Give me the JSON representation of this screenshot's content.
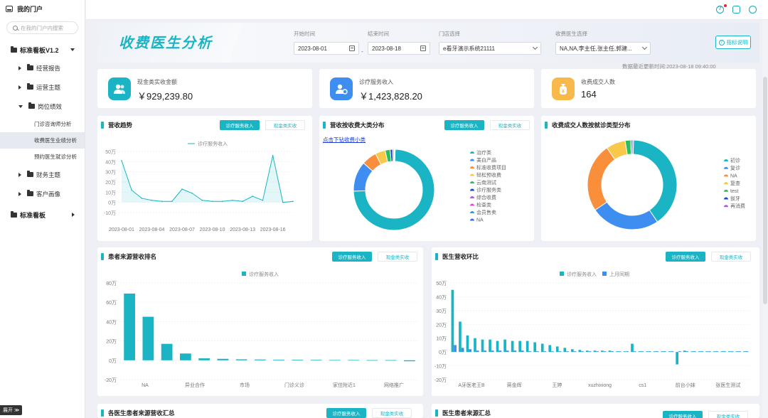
{
  "sidebar": {
    "portal": "我的门户",
    "search_placeholder": "在我的门户内搜索",
    "group1": "标准看板V1.2",
    "items": [
      "经营报告",
      "运营主题",
      "岗位绩效",
      "财务主题",
      "客户画像"
    ],
    "sub_items": [
      "门诊咨询师分析",
      "收费医生业绩分析",
      "预约医生就诊分析"
    ],
    "group2": "标准看板",
    "expand": "展开 ≫"
  },
  "header": {
    "title": "收费医生分析",
    "filters": {
      "start_label": "开始时间",
      "start_value": "2023-08-01",
      "end_label": "结束时间",
      "end_value": "2023-08-18",
      "store_label": "门店选择",
      "store_value": "e看牙演示系统21111",
      "doctor_label": "收费医生选择",
      "doctor_value": "NA,NA,李主任,张主任,郭建..."
    },
    "dash": "-",
    "doc_button": "指标说明",
    "update_time": "数据最近更新时间:2023-08-18 09:40:00"
  },
  "kpis": [
    {
      "label": "现金类实收金额",
      "value": "￥929,239.80",
      "color": "#1ab4c4"
    },
    {
      "label": "诊疗服务收入",
      "value": "￥1,423,828.20",
      "color": "#3d8ef0"
    },
    {
      "label": "收费成交人数",
      "value": "164",
      "color": "#f8b84a"
    }
  ],
  "buttons": {
    "primary": "诊疗服务收入",
    "ghost": "现金类实收"
  },
  "panels": {
    "trend": "营收趋势",
    "category": "营收按收费大类分布",
    "category_drill": "点击下钻收费小类",
    "visit": "收费成交人数按就诊类型分布",
    "source": "患者来源营收排名",
    "ratio": "医生营收环比",
    "bottom_left": "各医生患者来源营收汇总",
    "bottom_right": "医生患者来源汇总"
  },
  "chart_data": [
    {
      "type": "line",
      "title": "营收趋势",
      "series": [
        {
          "name": "诊疗服务收入",
          "values": [
            41,
            12,
            4,
            2,
            1,
            1,
            13,
            9,
            2,
            1,
            1,
            2,
            1,
            6,
            2,
            46,
            0,
            1
          ]
        }
      ],
      "x": [
        "2023-08-01",
        "2023-08-02",
        "2023-08-03",
        "2023-08-04",
        "2023-08-05",
        "2023-08-06",
        "2023-08-07",
        "2023-08-08",
        "2023-08-09",
        "2023-08-10",
        "2023-08-11",
        "2023-08-12",
        "2023-08-13",
        "2023-08-14",
        "2023-08-15",
        "2023-08-16",
        "2023-08-17",
        "2023-08-18"
      ],
      "x_ticks": [
        "2023-08-01",
        "2023-08-04",
        "2023-08-07",
        "2023-08-10",
        "2023-08-13",
        "2023-08-16"
      ],
      "ylim": [
        -10,
        50
      ],
      "y_ticks": [
        "-10万",
        "0万",
        "10万",
        "20万",
        "30万",
        "40万",
        "50万"
      ],
      "grid": true,
      "legend": "top"
    },
    {
      "type": "pie",
      "title": "营收按收费大类分布",
      "labels": [
        "治疗类",
        "美白产品",
        "标准收费项目",
        "轻松预收费",
        "云南测试",
        "诊疗服务类",
        "综合收费",
        "检查类",
        "会员售卖",
        "NA"
      ],
      "colors": [
        "#1ab4c4",
        "#3d8ef0",
        "#f98e3b",
        "#f9c84a",
        "#2bbf5a",
        "#1a48c8",
        "#a35fd9",
        "#e24ad1",
        "#1aa7e0",
        "#3d6af0"
      ],
      "values": [
        74,
        12,
        6,
        4,
        2,
        1,
        0.5,
        0.2,
        0.2,
        0.1
      ],
      "legend": "right"
    },
    {
      "type": "pie",
      "title": "收费成交人数按就诊类型分布",
      "labels": [
        "初诊",
        "复诊",
        "NA",
        "复查",
        "test",
        "拔牙",
        "再消费"
      ],
      "colors": [
        "#1ab4c4",
        "#3d8ef0",
        "#f98e3b",
        "#f9c84a",
        "#2bbf5a",
        "#1a48c8",
        "#a35fd9"
      ],
      "values": [
        40,
        25,
        25,
        7,
        2,
        0.5,
        0.5
      ],
      "legend": "right"
    },
    {
      "type": "bar",
      "title": "患者来源营收排名",
      "series": [
        {
          "name": "诊疗服务收入",
          "values": [
            69,
            45,
            17,
            7,
            2,
            1.5,
            1,
            0.8,
            0.6,
            0.5,
            0.4,
            0.3,
            0.3,
            0.2,
            0.2,
            -1
          ]
        }
      ],
      "x_ticks": [
        "NA",
        "异业合作",
        "市场",
        "门诊义诊",
        "家住附近1",
        "网络推广"
      ],
      "ylim": [
        -20,
        80
      ],
      "y_ticks": [
        "-20万",
        "0万",
        "20万",
        "40万",
        "60万",
        "80万"
      ],
      "grid": true,
      "legend": "top"
    },
    {
      "type": "bar",
      "title": "医生营收环比",
      "series": [
        {
          "name": "诊疗服务收入",
          "values": [
            45,
            22,
            12,
            10,
            9,
            9,
            8,
            9,
            8,
            8,
            8,
            7,
            6,
            5,
            4,
            3,
            2,
            1.5,
            1,
            1,
            1,
            1,
            0.5,
            0.5,
            6,
            0.5,
            0.5,
            0.5,
            0.5,
            0.5,
            -9,
            1,
            0.5,
            0.5,
            0.5,
            0.5,
            0.5,
            0.5,
            0.5,
            0.5
          ]
        },
        {
          "name": "上月同期",
          "values": [
            5,
            3,
            2,
            1,
            1,
            1,
            1,
            1,
            1,
            1,
            0.5,
            0.5,
            0.5,
            0.5,
            0.5,
            0.5,
            0.5,
            0.5,
            0.5,
            0.5,
            0.5,
            0.5,
            0.5,
            0.5,
            0.5,
            0.5,
            0.5,
            0.5,
            0.5,
            0.5,
            0.5,
            0.5,
            0.5,
            0.5,
            0.5,
            0.5,
            0.5,
            0.5,
            0.5,
            0.5
          ]
        }
      ],
      "x_ticks": [
        "A牙医老王B",
        "蒋金辉",
        "王婷",
        "xuzhixiong",
        "cs1",
        "前台小妹",
        "张医生测试"
      ],
      "ylim": [
        -20,
        50
      ],
      "y_ticks": [
        "-20万",
        "-10万",
        "0万",
        "10万",
        "20万",
        "30万",
        "40万",
        "50万"
      ],
      "grid": true,
      "legend": "top"
    }
  ]
}
